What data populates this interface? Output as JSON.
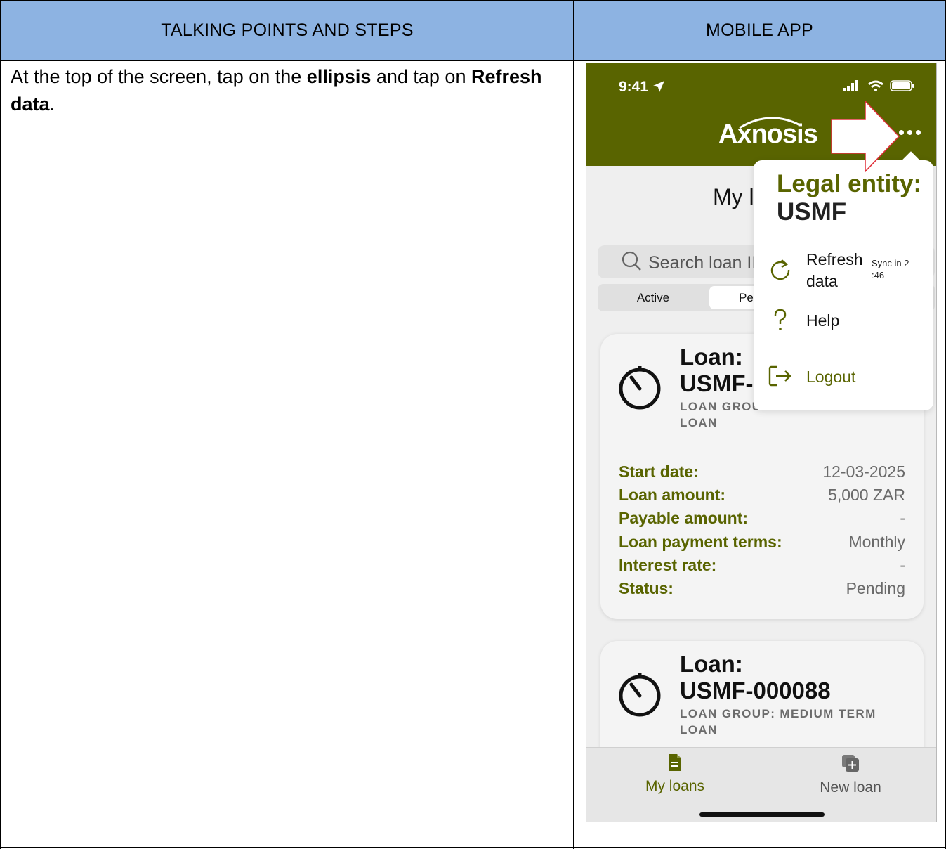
{
  "table": {
    "header_left": "TALKING POINTS AND STEPS",
    "header_right": "MOBILE APP",
    "header_color": "#8db3e2"
  },
  "step": {
    "part1": "At the top of the screen, tap on the ",
    "bold1": "ellipsis",
    "part2": " and tap on ",
    "bold2": "Refresh data",
    "part3": "."
  },
  "phone": {
    "status_time": "9:41",
    "brand_color": "#596400",
    "logo_text": "Axnosis",
    "page_title": "My l",
    "search_placeholder": "Search loan II",
    "segments": {
      "active": "Active",
      "pending": "Pe"
    },
    "menu": {
      "legal_entity_label": "Legal entity:",
      "legal_entity_value": "USMF",
      "refresh_label_line1": "Refresh",
      "refresh_label_line2": "data",
      "sync_line1": "Sync in 2",
      "sync_line2": ":46",
      "help_label": "Help",
      "logout_label": "Logout"
    },
    "card1": {
      "title_line1": "Loan:",
      "title_line2": "USMF-",
      "group_line1": "LOAN GROU",
      "group_line2": "LOAN",
      "rows": [
        {
          "label": "Start date:",
          "value": "12-03-2025"
        },
        {
          "label": "Loan amount:",
          "value": "5,000 ZAR"
        },
        {
          "label": "Payable amount:",
          "value": "-"
        },
        {
          "label": "Loan payment terms:",
          "value": "Monthly"
        },
        {
          "label": "Interest rate:",
          "value": "-"
        },
        {
          "label": "Status:",
          "value": "Pending"
        }
      ]
    },
    "card2": {
      "title_line1": "Loan:",
      "title_line2": "USMF-000088",
      "group_line1": "LOAN GROUP: MEDIUM TERM",
      "group_line2": "LOAN"
    },
    "nav": {
      "my_loans": "My loans",
      "new_loan": "New loan"
    }
  }
}
